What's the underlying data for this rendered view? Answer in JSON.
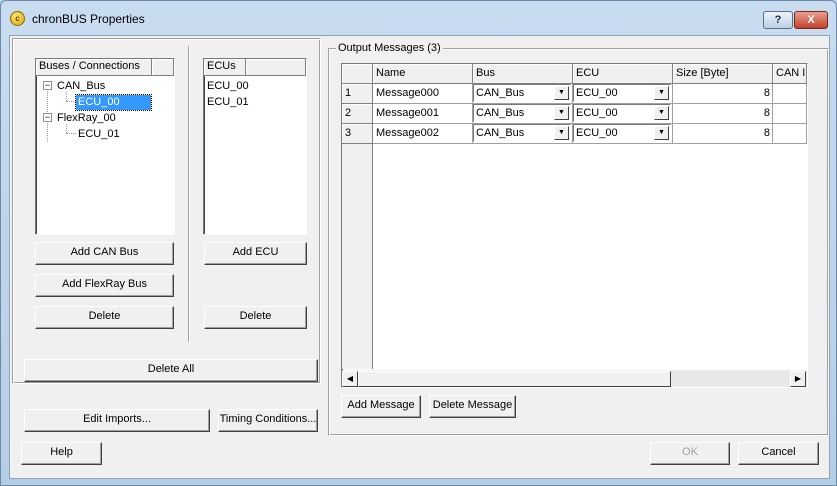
{
  "window": {
    "title": "chronBUS Properties",
    "help_button": "?",
    "close_button": "X"
  },
  "buses_panel": {
    "header": "Buses / Connections",
    "tree": [
      {
        "label": "CAN_Bus",
        "level": 0,
        "expander": "−"
      },
      {
        "label": "ECU_00",
        "level": 1,
        "selected": true
      },
      {
        "label": "FlexRay_00",
        "level": 0,
        "expander": "−"
      },
      {
        "label": "ECU_01",
        "level": 1
      }
    ],
    "add_can_bus": "Add CAN Bus",
    "add_flexray_bus": "Add FlexRay Bus",
    "delete": "Delete"
  },
  "ecus_panel": {
    "header": "ECUs",
    "items": [
      "ECU_00",
      "ECU_01"
    ],
    "add_ecu": "Add ECU",
    "delete": "Delete"
  },
  "delete_all": "Delete All",
  "edit_imports": "Edit Imports...",
  "timing_conditions": "Timing Conditions...",
  "output_messages": {
    "group_label": "Output Messages (3)",
    "columns": [
      "",
      "Name",
      "Bus",
      "ECU",
      "Size [Byte]",
      "CAN ID"
    ],
    "rows": [
      {
        "index": "1",
        "name": "Message000",
        "bus": "CAN_Bus",
        "ecu": "ECU_00",
        "size": "8"
      },
      {
        "index": "2",
        "name": "Message001",
        "bus": "CAN_Bus",
        "ecu": "ECU_00",
        "size": "8"
      },
      {
        "index": "3",
        "name": "Message002",
        "bus": "CAN_Bus",
        "ecu": "ECU_00",
        "size": "8"
      }
    ],
    "add_message": "Add Message",
    "delete_message": "Delete Message"
  },
  "footer": {
    "help": "Help",
    "ok": "OK",
    "cancel": "Cancel"
  },
  "icons": {
    "app": "chronbus-app-icon",
    "dropdown": "chevron-down-icon",
    "scroll_left": "arrow-left-icon",
    "scroll_right": "arrow-right-icon"
  }
}
